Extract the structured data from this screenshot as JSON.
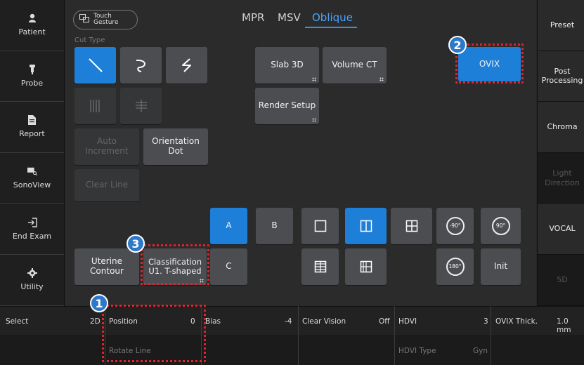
{
  "sidebar": {
    "items": [
      {
        "label": "Patient",
        "icon": "person-icon"
      },
      {
        "label": "Probe",
        "icon": "probe-icon"
      },
      {
        "label": "Report",
        "icon": "document-icon"
      },
      {
        "label": "SonoView",
        "icon": "sonoview-icon"
      },
      {
        "label": "End Exam",
        "icon": "exit-icon"
      },
      {
        "label": "Utility",
        "icon": "gear-icon"
      }
    ]
  },
  "right_panel": {
    "items": [
      {
        "label": "Preset"
      },
      {
        "label": "Post Processing"
      },
      {
        "label": "Chroma"
      },
      {
        "label": "Light Direction"
      },
      {
        "label": "VOCAL"
      },
      {
        "label": "5D"
      }
    ]
  },
  "tabs": [
    {
      "label": "MPR"
    },
    {
      "label": "MSV"
    },
    {
      "label": "Oblique"
    }
  ],
  "touch_gesture": {
    "line1": "Touch",
    "line2": "Gesture"
  },
  "cut_type_label": "Cut Type",
  "buttons": {
    "auto_increment": "Auto Increment",
    "orientation_dot": "Orientation Dot",
    "clear_line": "Clear Line",
    "slab_3d": "Slab 3D",
    "volume_ct": "Volume CT",
    "render_setup": "Render Setup",
    "ovix": "OVIX",
    "a": "A",
    "b": "B",
    "c": "C",
    "rot_minus90": "-90°",
    "rot_plus90": "90°",
    "rot_180": "180°",
    "init": "Init",
    "uterine_contour": "Uterine Contour",
    "classification": "Classification U1. T-shaped"
  },
  "badges": {
    "one": "1",
    "two": "2",
    "three": "3"
  },
  "bottom": {
    "select_label": "Select",
    "select_value": "2D",
    "position_label": "Position",
    "position_value": "0",
    "bias_label": "Bias",
    "bias_value": "-4",
    "clearvision_label": "Clear Vision",
    "clearvision_value": "Off",
    "hdvi_label": "HDVI",
    "hdvi_value": "3",
    "ovix_thick_label": "OVIX Thick.",
    "ovix_thick_value": "1.0 mm",
    "rotate_line": "Rotate Line",
    "hdvi_type_label": "HDVI Type",
    "hdvi_type_value": "Gyn"
  },
  "colors": {
    "accent": "#1e7fd8",
    "highlight": "#e0242b"
  }
}
